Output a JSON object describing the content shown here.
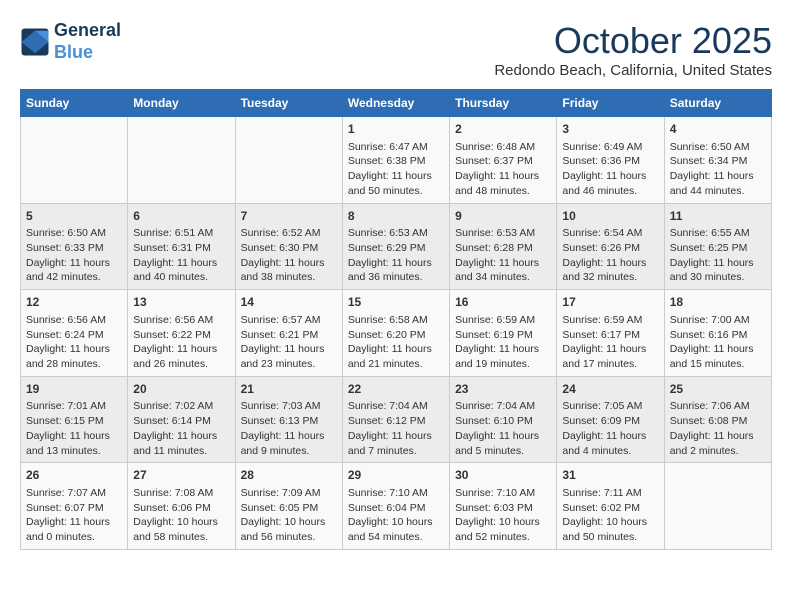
{
  "header": {
    "logo_line1": "General",
    "logo_line2": "Blue",
    "month": "October 2025",
    "location": "Redondo Beach, California, United States"
  },
  "weekdays": [
    "Sunday",
    "Monday",
    "Tuesday",
    "Wednesday",
    "Thursday",
    "Friday",
    "Saturday"
  ],
  "weeks": [
    [
      {
        "day": "",
        "content": ""
      },
      {
        "day": "",
        "content": ""
      },
      {
        "day": "",
        "content": ""
      },
      {
        "day": "1",
        "content": "Sunrise: 6:47 AM\nSunset: 6:38 PM\nDaylight: 11 hours and 50 minutes."
      },
      {
        "day": "2",
        "content": "Sunrise: 6:48 AM\nSunset: 6:37 PM\nDaylight: 11 hours and 48 minutes."
      },
      {
        "day": "3",
        "content": "Sunrise: 6:49 AM\nSunset: 6:36 PM\nDaylight: 11 hours and 46 minutes."
      },
      {
        "day": "4",
        "content": "Sunrise: 6:50 AM\nSunset: 6:34 PM\nDaylight: 11 hours and 44 minutes."
      }
    ],
    [
      {
        "day": "5",
        "content": "Sunrise: 6:50 AM\nSunset: 6:33 PM\nDaylight: 11 hours and 42 minutes."
      },
      {
        "day": "6",
        "content": "Sunrise: 6:51 AM\nSunset: 6:31 PM\nDaylight: 11 hours and 40 minutes."
      },
      {
        "day": "7",
        "content": "Sunrise: 6:52 AM\nSunset: 6:30 PM\nDaylight: 11 hours and 38 minutes."
      },
      {
        "day": "8",
        "content": "Sunrise: 6:53 AM\nSunset: 6:29 PM\nDaylight: 11 hours and 36 minutes."
      },
      {
        "day": "9",
        "content": "Sunrise: 6:53 AM\nSunset: 6:28 PM\nDaylight: 11 hours and 34 minutes."
      },
      {
        "day": "10",
        "content": "Sunrise: 6:54 AM\nSunset: 6:26 PM\nDaylight: 11 hours and 32 minutes."
      },
      {
        "day": "11",
        "content": "Sunrise: 6:55 AM\nSunset: 6:25 PM\nDaylight: 11 hours and 30 minutes."
      }
    ],
    [
      {
        "day": "12",
        "content": "Sunrise: 6:56 AM\nSunset: 6:24 PM\nDaylight: 11 hours and 28 minutes."
      },
      {
        "day": "13",
        "content": "Sunrise: 6:56 AM\nSunset: 6:22 PM\nDaylight: 11 hours and 26 minutes."
      },
      {
        "day": "14",
        "content": "Sunrise: 6:57 AM\nSunset: 6:21 PM\nDaylight: 11 hours and 23 minutes."
      },
      {
        "day": "15",
        "content": "Sunrise: 6:58 AM\nSunset: 6:20 PM\nDaylight: 11 hours and 21 minutes."
      },
      {
        "day": "16",
        "content": "Sunrise: 6:59 AM\nSunset: 6:19 PM\nDaylight: 11 hours and 19 minutes."
      },
      {
        "day": "17",
        "content": "Sunrise: 6:59 AM\nSunset: 6:17 PM\nDaylight: 11 hours and 17 minutes."
      },
      {
        "day": "18",
        "content": "Sunrise: 7:00 AM\nSunset: 6:16 PM\nDaylight: 11 hours and 15 minutes."
      }
    ],
    [
      {
        "day": "19",
        "content": "Sunrise: 7:01 AM\nSunset: 6:15 PM\nDaylight: 11 hours and 13 minutes."
      },
      {
        "day": "20",
        "content": "Sunrise: 7:02 AM\nSunset: 6:14 PM\nDaylight: 11 hours and 11 minutes."
      },
      {
        "day": "21",
        "content": "Sunrise: 7:03 AM\nSunset: 6:13 PM\nDaylight: 11 hours and 9 minutes."
      },
      {
        "day": "22",
        "content": "Sunrise: 7:04 AM\nSunset: 6:12 PM\nDaylight: 11 hours and 7 minutes."
      },
      {
        "day": "23",
        "content": "Sunrise: 7:04 AM\nSunset: 6:10 PM\nDaylight: 11 hours and 5 minutes."
      },
      {
        "day": "24",
        "content": "Sunrise: 7:05 AM\nSunset: 6:09 PM\nDaylight: 11 hours and 4 minutes."
      },
      {
        "day": "25",
        "content": "Sunrise: 7:06 AM\nSunset: 6:08 PM\nDaylight: 11 hours and 2 minutes."
      }
    ],
    [
      {
        "day": "26",
        "content": "Sunrise: 7:07 AM\nSunset: 6:07 PM\nDaylight: 11 hours and 0 minutes."
      },
      {
        "day": "27",
        "content": "Sunrise: 7:08 AM\nSunset: 6:06 PM\nDaylight: 10 hours and 58 minutes."
      },
      {
        "day": "28",
        "content": "Sunrise: 7:09 AM\nSunset: 6:05 PM\nDaylight: 10 hours and 56 minutes."
      },
      {
        "day": "29",
        "content": "Sunrise: 7:10 AM\nSunset: 6:04 PM\nDaylight: 10 hours and 54 minutes."
      },
      {
        "day": "30",
        "content": "Sunrise: 7:10 AM\nSunset: 6:03 PM\nDaylight: 10 hours and 52 minutes."
      },
      {
        "day": "31",
        "content": "Sunrise: 7:11 AM\nSunset: 6:02 PM\nDaylight: 10 hours and 50 minutes."
      },
      {
        "day": "",
        "content": ""
      }
    ]
  ]
}
